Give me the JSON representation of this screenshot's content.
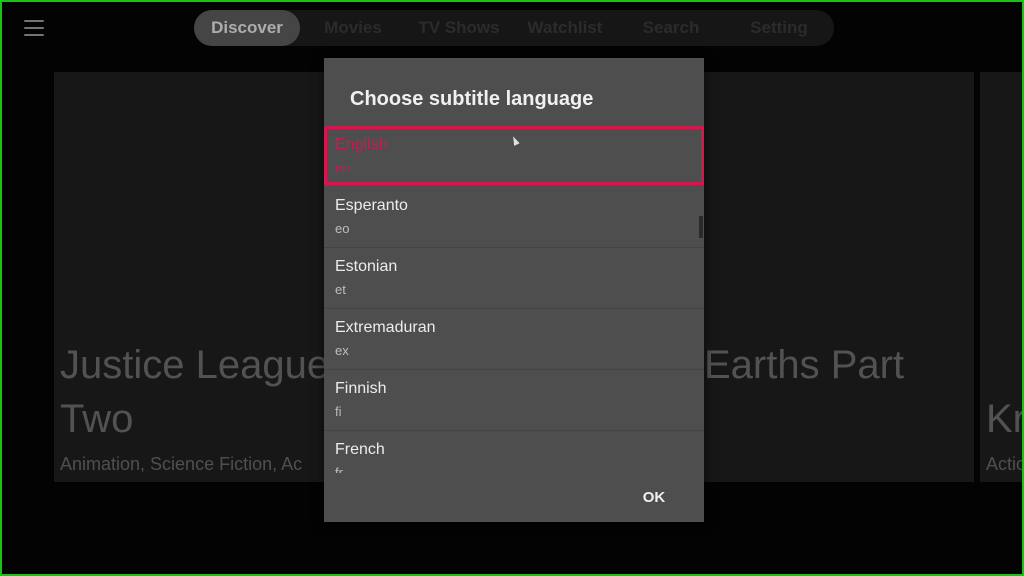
{
  "nav": {
    "items": [
      {
        "label": "Discover",
        "active": true
      },
      {
        "label": "Movies"
      },
      {
        "label": "TV Shows"
      },
      {
        "label": "Watchlist"
      },
      {
        "label": "Search"
      },
      {
        "label": "Setting"
      }
    ]
  },
  "cards": [
    {
      "title_line1": "Justice League",
      "title_line2": "Two",
      "genres": "Animation, Science Fiction, Ac"
    },
    {
      "title_line1": "Earths Part"
    },
    {
      "title_line1": "Kr",
      "genres": "Actio"
    }
  ],
  "dialog": {
    "title": "Choose subtitle language",
    "languages": [
      {
        "name": "English",
        "code": "en"
      },
      {
        "name": "Esperanto",
        "code": "eo"
      },
      {
        "name": "Estonian",
        "code": "et"
      },
      {
        "name": "Extremaduran",
        "code": "ex"
      },
      {
        "name": "Finnish",
        "code": "fi"
      },
      {
        "name": "French",
        "code": "fr"
      }
    ],
    "ok_label": "OK"
  },
  "colors": {
    "accent": "#d4184e",
    "frame": "#19c219"
  },
  "icons": {
    "menu": "hamburger-menu-icon",
    "cursor": "mouse-pointer-icon"
  }
}
